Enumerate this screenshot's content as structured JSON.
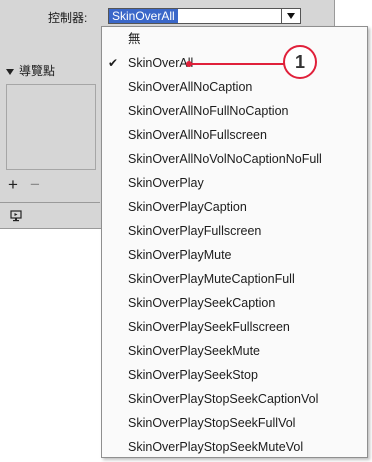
{
  "controls": {
    "label": "控制器:",
    "selected_value": "SkinOverAll"
  },
  "cue_points": {
    "header": "導覽點",
    "add_symbol": "+",
    "remove_symbol": "−"
  },
  "dropdown": {
    "options": [
      {
        "label": "無",
        "checked": false
      },
      {
        "label": "SkinOverAll",
        "checked": true
      },
      {
        "label": "SkinOverAllNoCaption",
        "checked": false
      },
      {
        "label": "SkinOverAllNoFullNoCaption",
        "checked": false
      },
      {
        "label": "SkinOverAllNoFullscreen",
        "checked": false
      },
      {
        "label": "SkinOverAllNoVolNoCaptionNoFull",
        "checked": false
      },
      {
        "label": "SkinOverPlay",
        "checked": false
      },
      {
        "label": "SkinOverPlayCaption",
        "checked": false
      },
      {
        "label": "SkinOverPlayFullscreen",
        "checked": false
      },
      {
        "label": "SkinOverPlayMute",
        "checked": false
      },
      {
        "label": "SkinOverPlayMuteCaptionFull",
        "checked": false
      },
      {
        "label": "SkinOverPlaySeekCaption",
        "checked": false
      },
      {
        "label": "SkinOverPlaySeekFullscreen",
        "checked": false
      },
      {
        "label": "SkinOverPlaySeekMute",
        "checked": false
      },
      {
        "label": "SkinOverPlaySeekStop",
        "checked": false
      },
      {
        "label": "SkinOverPlayStopSeekCaptionVol",
        "checked": false
      },
      {
        "label": "SkinOverPlayStopSeekFullVol",
        "checked": false
      },
      {
        "label": "SkinOverPlayStopSeekMuteVol",
        "checked": false
      }
    ],
    "check_symbol": "✔"
  },
  "callout": {
    "number": "1",
    "color": "#e0203a"
  },
  "colors": {
    "panel_bg": "#d6d6d6",
    "selection_bg": "#3a67c9"
  }
}
